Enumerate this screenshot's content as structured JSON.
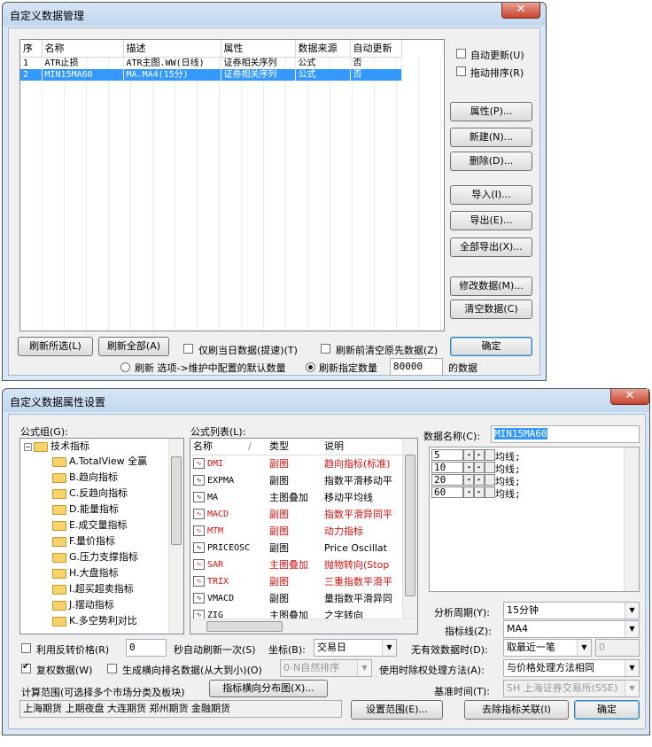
{
  "win1": {
    "title": "自定义数据管理",
    "close": "✕",
    "columns": [
      "序",
      "名称",
      "描述",
      "属性",
      "数据来源",
      "自动更新"
    ],
    "rows": [
      [
        "1",
        "ATR止损",
        "ATR主图.WW(日线)",
        "证券相关序列",
        "公式",
        "否"
      ],
      [
        "2",
        "MIN15MA60",
        "MA.MA4(15分)",
        "证券相关序列",
        "公式",
        "否"
      ]
    ],
    "chk_auto_update": "自动更新(U)",
    "chk_drag_sort": "拖动排序(R)",
    "btn_props": "属性(P)...",
    "btn_new": "新建(N)...",
    "btn_delete": "删除(D)...",
    "btn_import": "导入(I)...",
    "btn_export": "导出(E)...",
    "btn_export_all": "全部导出(X)...",
    "btn_modify": "修改数据(M)...",
    "btn_clear": "清空数据(C)",
    "btn_refresh_sel": "刷新所选(L)",
    "btn_refresh_all": "刷新全部(A)",
    "chk_today_only": "仅刷当日数据(提速)(T)",
    "chk_clear_before": "刷新前清空原先数据(Z)",
    "btn_ok": "确定",
    "radio_refresh_opt": "刷新 选项->维护中配置的默认数量",
    "radio_refresh_count": "刷新指定数量",
    "refresh_count_value": "80000",
    "refresh_count_suffix": "的数据"
  },
  "win2": {
    "title": "自定义数据属性设置",
    "close": "✕",
    "formula_group_label": "公式组(G):",
    "tree_root": "技术指标",
    "tree_items": [
      "A.TotalView 全赢",
      "B.趋向指标",
      "C.反趋向指标",
      "D.能量指标",
      "E.成交量指标",
      "F.量价指标",
      "G.压力支撑指标",
      "H.大盘指标",
      "I.超买超卖指标",
      "J.摆动指标",
      "K.多空势利对比"
    ],
    "formula_list_label": "公式列表(L):",
    "list_headers": [
      "名称",
      "/",
      "类型",
      "说明"
    ],
    "formulas": [
      {
        "name": "DMI",
        "type": "副图",
        "desc": "趋向指标(标准)",
        "red": true
      },
      {
        "name": "EXPMA",
        "type": "副图",
        "desc": "指数平滑移动平",
        "red": false
      },
      {
        "name": "MA",
        "type": "主图叠加",
        "desc": "移动平均线",
        "red": false
      },
      {
        "name": "MACD",
        "type": "副图",
        "desc": "指数平滑异同平",
        "red": true
      },
      {
        "name": "MTM",
        "type": "副图",
        "desc": "动力指标",
        "red": true
      },
      {
        "name": "PRICEOSC",
        "type": "副图",
        "desc": "Price Oscillat",
        "red": false
      },
      {
        "name": "SAR",
        "type": "主图叠加",
        "desc": "抛物转向(Stop",
        "red": true
      },
      {
        "name": "TRIX",
        "type": "副图",
        "desc": "三重指数平滑平",
        "red": true
      },
      {
        "name": "VMACD",
        "type": "副图",
        "desc": "量指数平滑异同",
        "red": false
      },
      {
        "name": "ZIG",
        "type": "主图叠加",
        "desc": "之字转向",
        "red": false
      }
    ],
    "data_name_label": "数据名称(C):",
    "data_name_value": "MIN15MA60",
    "params": [
      {
        "value": "5",
        "text": "均线;"
      },
      {
        "value": "10",
        "text": "均线;"
      },
      {
        "value": "20",
        "text": "均线;"
      },
      {
        "value": "60",
        "text": "均线;"
      }
    ],
    "period_label": "分析周期(Y):",
    "period_value": "15分钟",
    "indicator_line_label": "指标线(Z):",
    "indicator_line_value": "MA4",
    "chk_reverse_price": "利用反转价格(R)",
    "auto_refresh_value": "0",
    "auto_refresh_label": "秒自动刷新一次(S)",
    "coord_label": "坐标(B):",
    "coord_value": "交易日",
    "invalid_label": "无有效数据时(D):",
    "invalid_value": "取最近一笔",
    "invalid_extra": "0",
    "chk_adjusted": "复权数据(W)",
    "chk_rank": "生成横向排名数据(从大到小)(O)",
    "rank_value": "0-N自然排序",
    "exright_label": "使用时除权处理方法(A):",
    "exright_value": "与价格处理方法相同",
    "calc_range_label": "计算范围(可选择多个市场分类及板块)",
    "btn_dist": "指标横向分布图(X)...",
    "base_time_label": "基准时间(T):",
    "base_time_value": "SH 上海证券交易所(SSE)",
    "markets": "上海期货  上期夜盘  大连期货  郑州期货  金融期货",
    "btn_set_range": "设置范围(E)...",
    "btn_remove_link": "去除指标关联(I)",
    "btn_ok": "确定"
  }
}
